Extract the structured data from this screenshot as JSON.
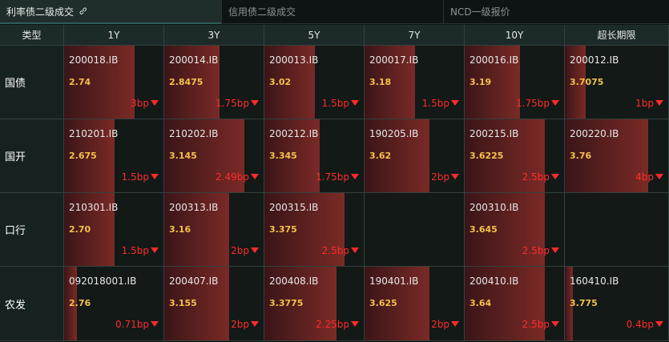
{
  "tabs": [
    {
      "label": "利率债二级成交",
      "active": true
    },
    {
      "label": "信用债二级成交",
      "active": false
    },
    {
      "label": "NCD一级报价",
      "active": false
    }
  ],
  "link_icon": "link-icon",
  "columns": [
    "类型",
    "1Y",
    "3Y",
    "5Y",
    "7Y",
    "10Y",
    "超长期限"
  ],
  "rows": [
    {
      "type": "国债",
      "cells": [
        {
          "code": "200018.IB",
          "rate": "2.74",
          "change": "3bp",
          "fill": 0.7
        },
        {
          "code": "200014.IB",
          "rate": "2.8475",
          "change": "1.75bp",
          "fill": 0.55
        },
        {
          "code": "200013.IB",
          "rate": "3.02",
          "change": "1.5bp",
          "fill": 0.5
        },
        {
          "code": "200017.IB",
          "rate": "3.18",
          "change": "1.5bp",
          "fill": 0.5
        },
        {
          "code": "200016.IB",
          "rate": "3.19",
          "change": "1.75bp",
          "fill": 0.55
        },
        {
          "code": "200012.IB",
          "rate": "3.7075",
          "change": "1bp",
          "fill": 0.2
        }
      ]
    },
    {
      "type": "国开",
      "cells": [
        {
          "code": "210201.IB",
          "rate": "2.675",
          "change": "1.5bp",
          "fill": 0.5
        },
        {
          "code": "210202.IB",
          "rate": "3.145",
          "change": "2.49bp",
          "fill": 0.8
        },
        {
          "code": "200212.IB",
          "rate": "3.345",
          "change": "1.75bp",
          "fill": 0.55
        },
        {
          "code": "190205.IB",
          "rate": "3.62",
          "change": "2bp",
          "fill": 0.65
        },
        {
          "code": "200215.IB",
          "rate": "3.6225",
          "change": "2.5bp",
          "fill": 0.8
        },
        {
          "code": "200220.IB",
          "rate": "3.76",
          "change": "4bp",
          "fill": 0.8
        }
      ]
    },
    {
      "type": "口行",
      "cells": [
        {
          "code": "210301.IB",
          "rate": "2.70",
          "change": "1.5bp",
          "fill": 0.5
        },
        {
          "code": "200313.IB",
          "rate": "3.16",
          "change": "2bp",
          "fill": 0.65
        },
        {
          "code": "200315.IB",
          "rate": "3.375",
          "change": "2.5bp",
          "fill": 0.8
        },
        {
          "code": "",
          "rate": "",
          "change": "",
          "fill": 0
        },
        {
          "code": "200310.IB",
          "rate": "3.645",
          "change": "2.5bp",
          "fill": 0.8
        },
        {
          "code": "",
          "rate": "",
          "change": "",
          "fill": 0
        }
      ]
    },
    {
      "type": "农发",
      "cells": [
        {
          "code": "092018001.IB",
          "rate": "2.76",
          "change": "0.71bp",
          "fill": 0.13
        },
        {
          "code": "200407.IB",
          "rate": "3.155",
          "change": "2bp",
          "fill": 0.65
        },
        {
          "code": "200408.IB",
          "rate": "3.3775",
          "change": "2.25bp",
          "fill": 0.72
        },
        {
          "code": "190401.IB",
          "rate": "3.625",
          "change": "2bp",
          "fill": 0.65
        },
        {
          "code": "200410.IB",
          "rate": "3.64",
          "change": "2.5bp",
          "fill": 0.8
        },
        {
          "code": "160410.IB",
          "rate": "3.775",
          "change": "0.4bp",
          "fill": 0.08
        }
      ]
    }
  ]
}
